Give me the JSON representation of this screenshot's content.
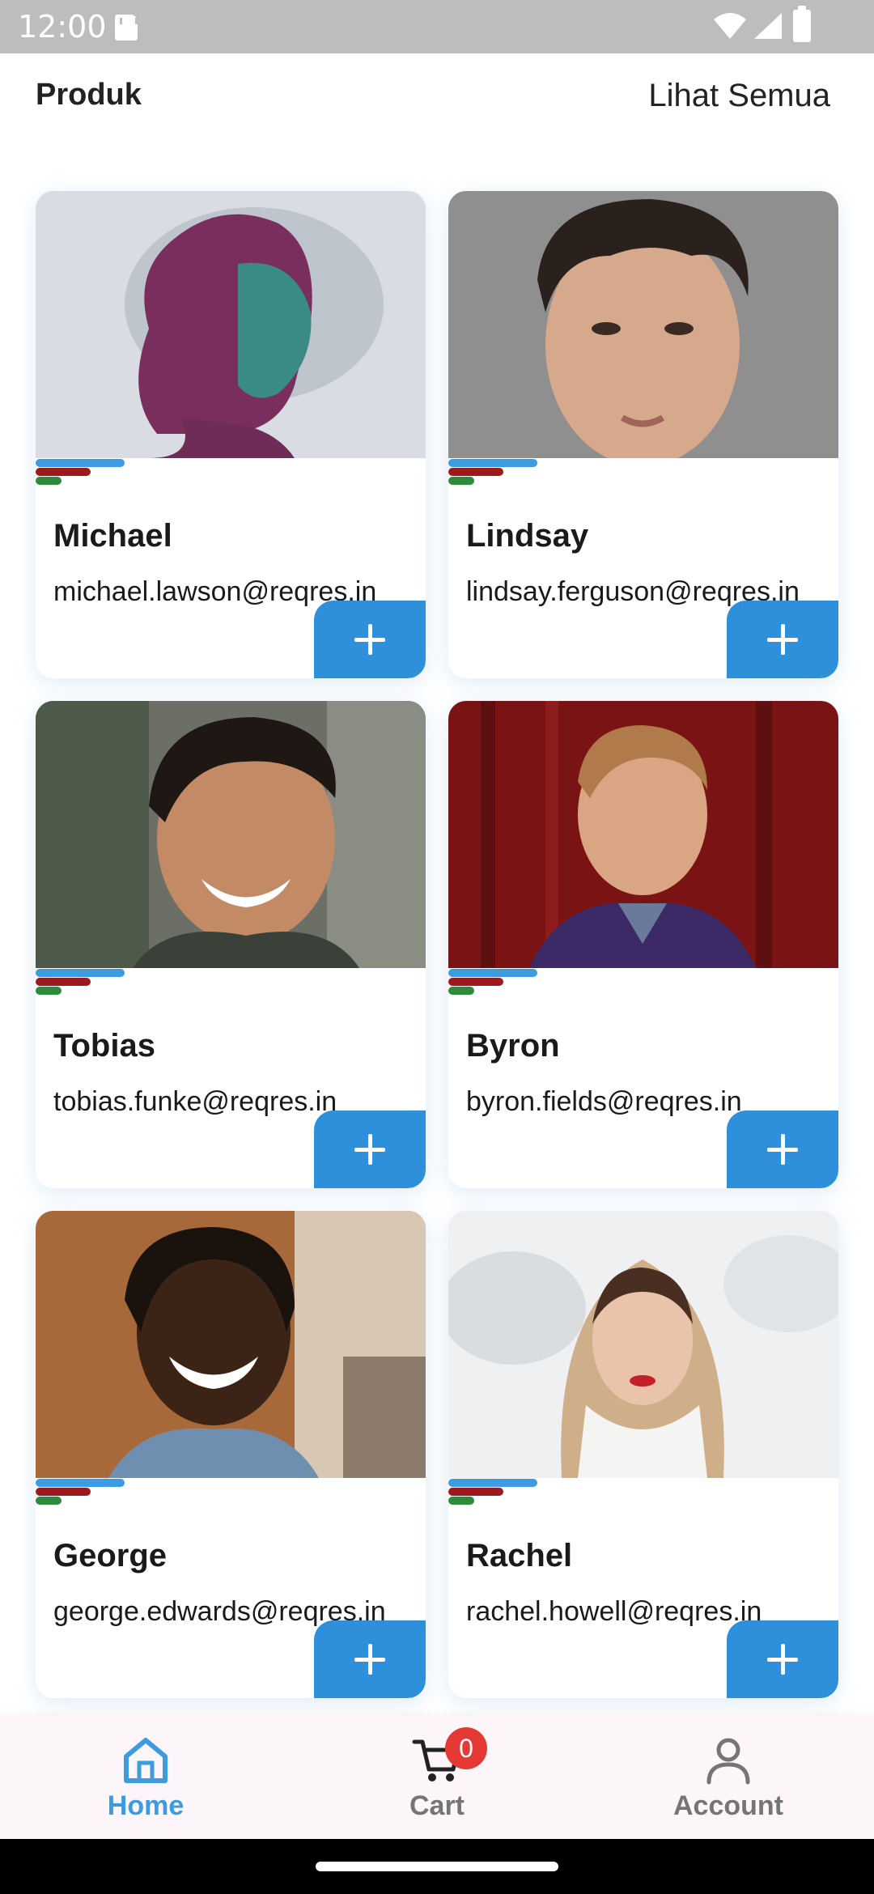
{
  "status_bar": {
    "time": "12:00"
  },
  "header": {
    "title": "Produk",
    "view_all": "Lihat Semua"
  },
  "products": [
    {
      "name": "Michael",
      "email": "michael.lawson@reqres.in"
    },
    {
      "name": "Lindsay",
      "email": "lindsay.ferguson@reqres.in"
    },
    {
      "name": "Tobias",
      "email": "tobias.funke@reqres.in"
    },
    {
      "name": "Byron",
      "email": "byron.fields@reqres.in"
    },
    {
      "name": "George",
      "email": "george.edwards@reqres.in"
    },
    {
      "name": "Rachel",
      "email": "rachel.howell@reqres.in"
    }
  ],
  "bottom_nav": {
    "home": "Home",
    "cart": "Cart",
    "cart_count": "0",
    "account": "Account"
  },
  "colors": {
    "accent": "#2e90db",
    "bar_blue": "#3d9be0",
    "bar_red": "#9c1a1e",
    "bar_green": "#2e8b3c",
    "badge": "#e53935"
  }
}
